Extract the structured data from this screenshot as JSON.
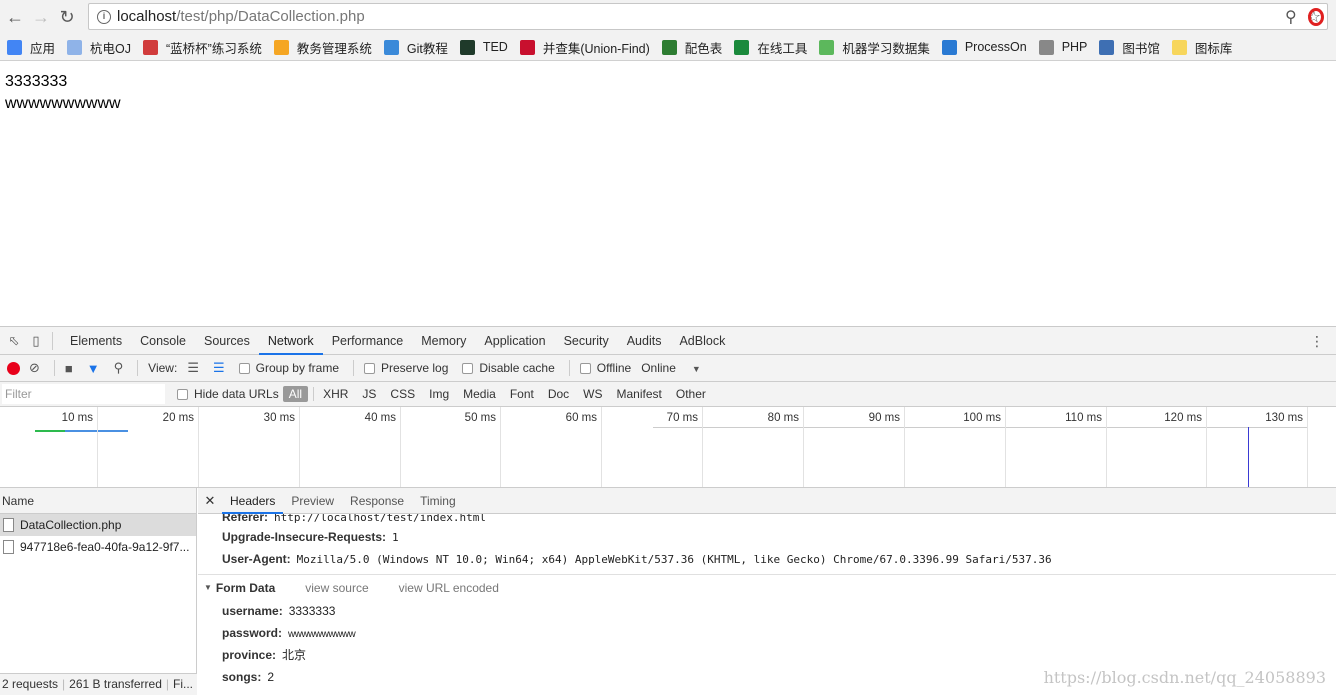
{
  "browser": {
    "url_host": "localhost",
    "url_path": "/test/php/DataCollection.php",
    "bookmarks": [
      {
        "label": "应用",
        "color": "#4285f4"
      },
      {
        "label": "杭电OJ",
        "color": "#8fb3e8"
      },
      {
        "label": "“蓝桥杯”练习系统",
        "color": "#d13c3c"
      },
      {
        "label": "教务管理系统",
        "color": "#f5a623"
      },
      {
        "label": "Git教程",
        "color": "#3b8ad9"
      },
      {
        "label": "TED",
        "color": "#1f3a2a"
      },
      {
        "label": "并查集(Union-Find)",
        "color": "#c8102e"
      },
      {
        "label": "配色表",
        "color": "#2e7d32"
      },
      {
        "label": "在线工具",
        "color": "#1b8a3c"
      },
      {
        "label": "机器学习数据集",
        "color": "#5cb85c"
      },
      {
        "label": "ProcessOn",
        "color": "#2a7ad3"
      },
      {
        "label": "PHP",
        "color": "#888888"
      },
      {
        "label": "图书馆",
        "color": "#3e6fb3"
      },
      {
        "label": "图标库",
        "color": "#f7d65c"
      }
    ]
  },
  "page": {
    "line1": "3333333",
    "line2": "wwwwwwwwww"
  },
  "devtools": {
    "tabs": [
      "Elements",
      "Console",
      "Sources",
      "Network",
      "Performance",
      "Memory",
      "Application",
      "Security",
      "Audits",
      "AdBlock"
    ],
    "active_tab": "Network",
    "controls": {
      "view_label": "View:",
      "group_by_frame": "Group by frame",
      "preserve_log": "Preserve log",
      "disable_cache": "Disable cache",
      "offline": "Offline",
      "throttle": "Online"
    },
    "filter": {
      "placeholder": "Filter",
      "hide_data_urls": "Hide data URLs",
      "types": [
        "All",
        "XHR",
        "JS",
        "CSS",
        "Img",
        "Media",
        "Font",
        "Doc",
        "WS",
        "Manifest",
        "Other"
      ]
    },
    "timeline_ticks": [
      "10 ms",
      "20 ms",
      "30 ms",
      "40 ms",
      "50 ms",
      "60 ms",
      "70 ms",
      "80 ms",
      "90 ms",
      "100 ms",
      "110 ms",
      "120 ms",
      "130 ms"
    ],
    "requests": {
      "column": "Name",
      "rows": [
        "DataCollection.php",
        "947718e6-fea0-40fa-9a12-9f7..."
      ],
      "status_count": "2 requests",
      "status_transfer": "261 B transferred",
      "status_more": "Fi..."
    },
    "detail": {
      "tabs": [
        "Headers",
        "Preview",
        "Response",
        "Timing"
      ],
      "active_tab": "Headers",
      "headers": [
        {
          "name": "Referer:",
          "value": "http://localhost/test/index.html"
        },
        {
          "name": "Upgrade-Insecure-Requests:",
          "value": "1"
        },
        {
          "name": "User-Agent:",
          "value": "Mozilla/5.0 (Windows NT 10.0; Win64; x64) AppleWebKit/537.36 (KHTML, like Gecko) Chrome/67.0.3396.99 Safari/537.36"
        }
      ],
      "form_data": {
        "title": "Form Data",
        "view_source": "view source",
        "view_url_encoded": "view URL encoded",
        "fields": [
          {
            "name": "username:",
            "value": "3333333"
          },
          {
            "name": "password:",
            "value": "wwwwwwwwww"
          },
          {
            "name": "province:",
            "value": "北京"
          },
          {
            "name": "songs:",
            "value": "2"
          }
        ]
      }
    }
  },
  "watermark": "https://blog.csdn.net/qq_24058893"
}
